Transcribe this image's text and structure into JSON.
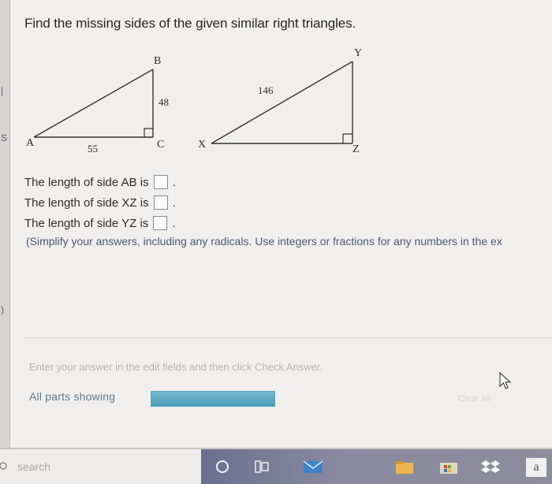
{
  "problem": {
    "title": "Find the missing sides of the given similar right triangles.",
    "triangle_1": {
      "vertex_a": "A",
      "vertex_b": "B",
      "vertex_c": "C",
      "side_ac": "55",
      "side_bc": "48"
    },
    "triangle_2": {
      "vertex_x": "X",
      "vertex_y": "Y",
      "vertex_z": "Z",
      "side_xy": "146"
    }
  },
  "questions": {
    "ab": "The length of side AB is",
    "xz": "The length of side XZ is",
    "yz": "The length of side YZ is",
    "ab_period": ".",
    "xz_period": ".",
    "yz_period": ".",
    "note": "(Simplify your answers, including any radicals. Use integers or fractions for any numbers in the ex"
  },
  "footer": {
    "instruction": "Enter your answer in the edit fields and then click Check Answer.",
    "parts_label": "All parts showing",
    "progress": 1.0,
    "clear_all": "Clear All"
  },
  "taskbar": {
    "search_placeholder": "search",
    "app_letter": "a",
    "icons": [
      "search-icon",
      "cortana-icon",
      "task-view-icon",
      "mail-icon",
      "file-explorer-icon",
      "store-icon",
      "dropbox-icon"
    ]
  },
  "colors": {
    "page": "#f1efee",
    "accent": "#4d9fb8",
    "text": "#2d2d2d"
  }
}
